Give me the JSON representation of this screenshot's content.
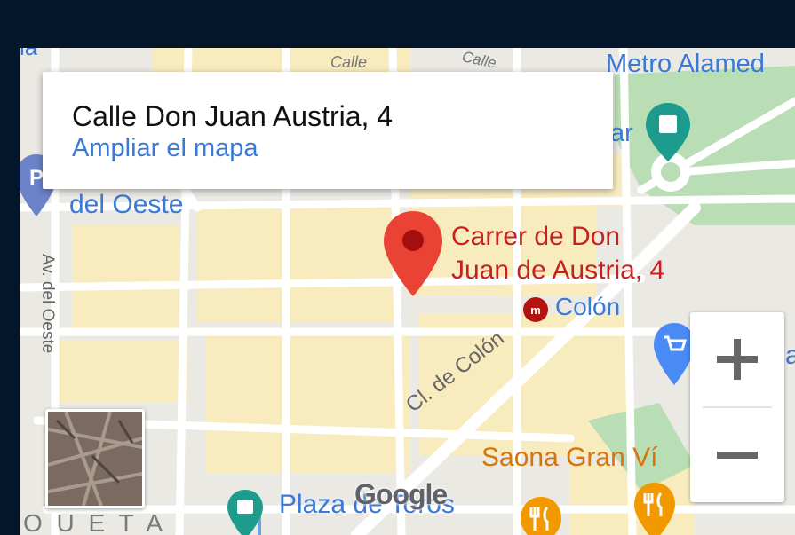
{
  "infowindow": {
    "address": "Calle Don Juan Austria, 4",
    "link": "Ampliar el mapa"
  },
  "map_labels": {
    "metro_alameda": "Metro Alamed",
    "calle_1": "Calle",
    "calle_2": "Calle",
    "del_oeste": "del Oeste",
    "av_del_oeste": "Av. del Oeste",
    "marker_line1": "Carrer de Don",
    "marker_line2": "Juan de Austria, 4",
    "colon_metro": "Colón",
    "cl_de_colon": "Cl. de Colón",
    "saona": "Saona Gran Ví",
    "plaza": "Plaza de Toros",
    "bottom_partial": "O U E T A",
    "ar_partial": "ar",
    "ia_partial": "ia",
    "a_partial": "a"
  },
  "branding": {
    "google_logo": "Google"
  },
  "zoom": {
    "in": "+",
    "out": "−"
  },
  "colors": {
    "accent_link": "#3b79d6",
    "marker_red": "#ea4335",
    "poi_orange": "#f29900",
    "poi_blue": "#4a8af4",
    "park_green": "#b9ddb4",
    "transit_blue": "#1a73e8",
    "frame_bg": "#03162b"
  }
}
